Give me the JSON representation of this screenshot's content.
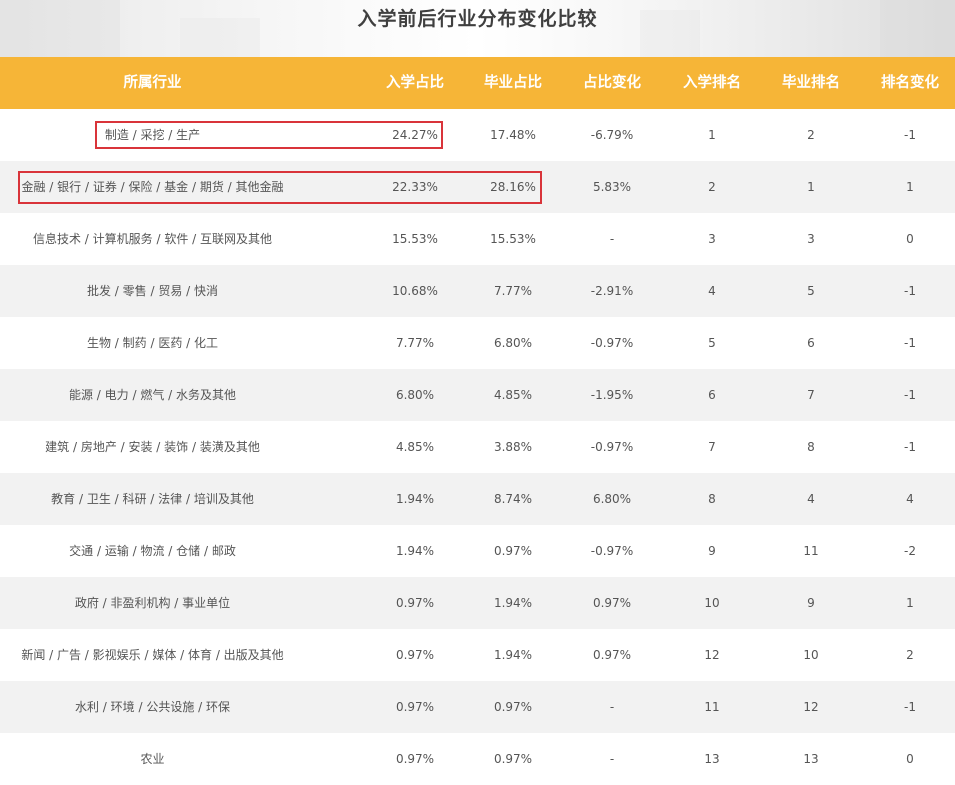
{
  "title": "入学前后行业分布变化比较",
  "header": {
    "industry": "所属行业",
    "entry_share": "入学占比",
    "grad_share": "毕业占比",
    "share_change": "占比变化",
    "entry_rank": "入学排名",
    "grad_rank": "毕业排名",
    "rank_change": "排名变化"
  },
  "rows": [
    {
      "industry": "制造 / 采挖 / 生产",
      "entry_share": "24.27%",
      "grad_share": "17.48%",
      "share_change": "-6.79%",
      "entry_rank": "1",
      "grad_rank": "2",
      "rank_change": "-1"
    },
    {
      "industry": "金融 / 银行 / 证券 / 保险 / 基金 / 期货 / 其他金融",
      "entry_share": "22.33%",
      "grad_share": "28.16%",
      "share_change": "5.83%",
      "entry_rank": "2",
      "grad_rank": "1",
      "rank_change": "1"
    },
    {
      "industry": "信息技术 / 计算机服务 / 软件 / 互联网及其他",
      "entry_share": "15.53%",
      "grad_share": "15.53%",
      "share_change": "-",
      "entry_rank": "3",
      "grad_rank": "3",
      "rank_change": "0"
    },
    {
      "industry": "批发 / 零售 / 贸易 / 快消",
      "entry_share": "10.68%",
      "grad_share": "7.77%",
      "share_change": "-2.91%",
      "entry_rank": "4",
      "grad_rank": "5",
      "rank_change": "-1"
    },
    {
      "industry": "生物 / 制药 / 医药 / 化工",
      "entry_share": "7.77%",
      "grad_share": "6.80%",
      "share_change": "-0.97%",
      "entry_rank": "5",
      "grad_rank": "6",
      "rank_change": "-1"
    },
    {
      "industry": "能源 / 电力 / 燃气 / 水务及其他",
      "entry_share": "6.80%",
      "grad_share": "4.85%",
      "share_change": "-1.95%",
      "entry_rank": "6",
      "grad_rank": "7",
      "rank_change": "-1"
    },
    {
      "industry": "建筑 / 房地产 / 安装 / 装饰 / 装潢及其他",
      "entry_share": "4.85%",
      "grad_share": "3.88%",
      "share_change": "-0.97%",
      "entry_rank": "7",
      "grad_rank": "8",
      "rank_change": "-1"
    },
    {
      "industry": "教育 / 卫生 / 科研 / 法律 / 培训及其他",
      "entry_share": "1.94%",
      "grad_share": "8.74%",
      "share_change": "6.80%",
      "entry_rank": "8",
      "grad_rank": "4",
      "rank_change": "4"
    },
    {
      "industry": "交通 / 运输 / 物流 / 仓储 / 邮政",
      "entry_share": "1.94%",
      "grad_share": "0.97%",
      "share_change": "-0.97%",
      "entry_rank": "9",
      "grad_rank": "11",
      "rank_change": "-2"
    },
    {
      "industry": "政府 / 非盈利机构 / 事业单位",
      "entry_share": "0.97%",
      "grad_share": "1.94%",
      "share_change": "0.97%",
      "entry_rank": "10",
      "grad_rank": "9",
      "rank_change": "1"
    },
    {
      "industry": "新闻 / 广告 / 影视娱乐 / 媒体 / 体育 / 出版及其他",
      "entry_share": "0.97%",
      "grad_share": "1.94%",
      "share_change": "0.97%",
      "entry_rank": "12",
      "grad_rank": "10",
      "rank_change": "2"
    },
    {
      "industry": "水利 / 环境 / 公共设施 / 环保",
      "entry_share": "0.97%",
      "grad_share": "0.97%",
      "share_change": "-",
      "entry_rank": "11",
      "grad_rank": "12",
      "rank_change": "-1"
    },
    {
      "industry": "农业",
      "entry_share": "0.97%",
      "grad_share": "0.97%",
      "share_change": "-",
      "entry_rank": "13",
      "grad_rank": "13",
      "rank_change": "0"
    }
  ],
  "colors": {
    "header_bg": "#f6b537",
    "highlight_border": "#d9343a",
    "row_alt_bg": "#f2f2f2"
  }
}
